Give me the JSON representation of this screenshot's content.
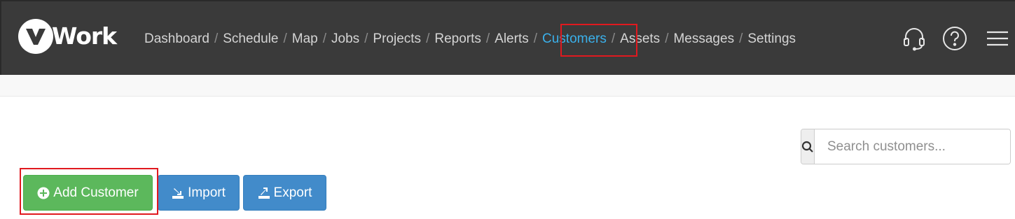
{
  "brand": {
    "logo_text": "Work",
    "logo_letter": "v"
  },
  "nav": {
    "items": [
      {
        "label": "Dashboard"
      },
      {
        "label": "Schedule"
      },
      {
        "label": "Map"
      },
      {
        "label": "Jobs"
      },
      {
        "label": "Projects"
      },
      {
        "label": "Reports"
      },
      {
        "label": "Alerts"
      },
      {
        "label": "Customers",
        "active": true
      },
      {
        "label": "Assets"
      },
      {
        "label": "Messages"
      },
      {
        "label": "Settings"
      }
    ],
    "separator": "/"
  },
  "header_icons": [
    "headset-icon",
    "help-circle-icon",
    "hamburger-menu-icon"
  ],
  "search": {
    "placeholder": "Search customers...",
    "value": ""
  },
  "actions": {
    "add_label": "Add Customer",
    "import_label": "Import",
    "export_label": "Export"
  },
  "colors": {
    "navbar": "#3a3a3a",
    "active_nav": "#3ab0ea",
    "add_button": "#5cb85c",
    "primary_button": "#428bca",
    "highlight": "#e0191f"
  }
}
